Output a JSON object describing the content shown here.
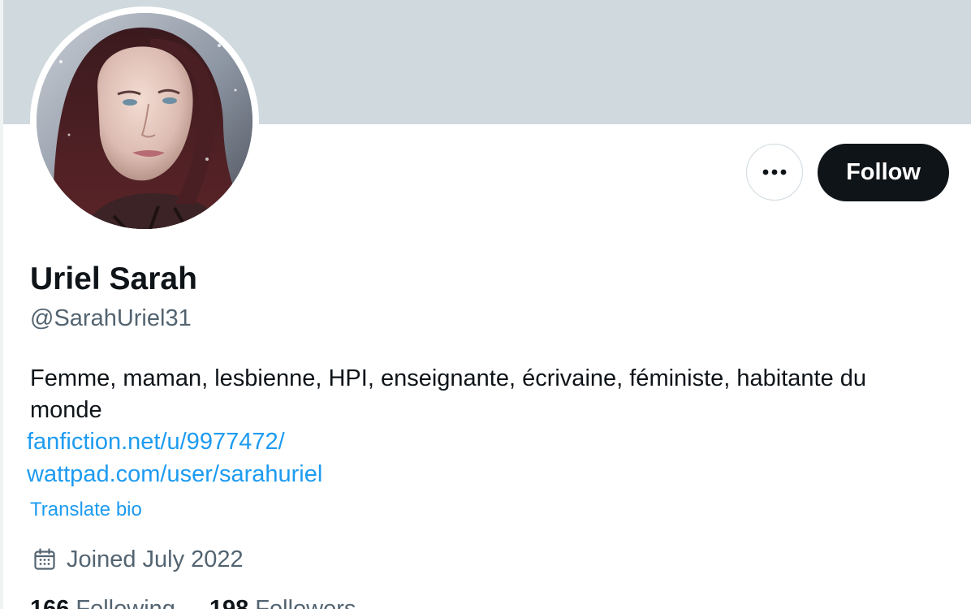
{
  "profile": {
    "display_name": "Uriel Sarah",
    "handle": "@SarahUriel31",
    "bio": "Femme, maman, lesbienne, HPI, enseignante, écrivaine, féministe, habitante du monde",
    "links": [
      "fanfiction.net/u/9977472/",
      "wattpad.com/user/sarahuriel"
    ],
    "translate_label": "Translate bio",
    "joined": "Joined July 2022",
    "joined_icon": "calendar-icon",
    "stats": [
      {
        "value": "166",
        "label": "Following"
      },
      {
        "value": "198",
        "label": "Followers"
      }
    ]
  },
  "actions": {
    "more_icon": "more-icon",
    "follow_label": "Follow"
  },
  "colors": {
    "banner": "#cfd9de",
    "text_primary": "#0f1419",
    "text_secondary": "#536471",
    "link": "#1d9bf0",
    "follow_button_bg": "#0f1419",
    "follow_button_text": "#ffffff"
  }
}
